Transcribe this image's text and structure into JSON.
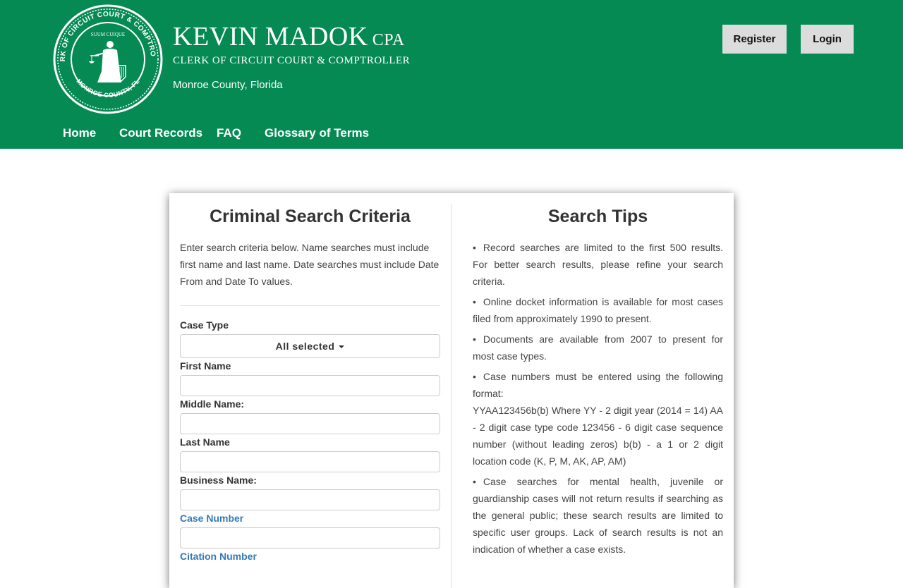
{
  "header": {
    "name": "KEVIN MADOK",
    "suffix": "CPA",
    "subtitle": "CLERK OF CIRCUIT COURT & COMPTROLLER",
    "county": "Monroe County, Florida",
    "register_label": "Register",
    "login_label": "Login",
    "seal": {
      "outer_text": "CLERK OF CIRCUIT COURT & COMPTROLLER",
      "inner_text": "SUUM CUIQUE",
      "bottom_text": "MONROE COUNTY, FL"
    }
  },
  "nav": {
    "items": [
      "Home",
      "Court Records",
      "FAQ",
      "Glossary of Terms"
    ]
  },
  "form": {
    "title": "Criminal Search Criteria",
    "intro": "Enter search criteria below. Name searches must include first name and last name. Date searches must include Date From and Date To values.",
    "case_type_label": "Case Type",
    "case_type_value": "All selected",
    "first_name_label": "First Name",
    "middle_name_label": "Middle Name:",
    "last_name_label": "Last Name",
    "business_name_label": "Business Name:",
    "case_number_label": "Case Number",
    "citation_number_label": "Citation Number"
  },
  "tips": {
    "title": "Search Tips",
    "items": [
      "Record searches are limited to the first 500 results. For better search results, please refine your search criteria.",
      "Online docket information is available for most cases filed from approximately 1990 to present.",
      "Documents are available from 2007 to present for most case types.",
      "Case numbers must be entered using the following format:",
      "YYAA123456b(b) Where YY - 2 digit year (2014 = 14) AA - 2 digit case type code 123456 - 6 digit case sequence number (without leading zeros) b(b) - a 1 or 2 digit location code (K, P, M, AK, AP, AM)",
      "Case searches for mental health, juvenile or guardianship cases will not return results if searching as the general public; these search results are limited to specific user groups. Lack of search results is not an indication of whether a case exists."
    ]
  },
  "colors": {
    "header_bg": "#058a54",
    "link": "#337ab7",
    "button_bg": "#dcdcdc"
  }
}
